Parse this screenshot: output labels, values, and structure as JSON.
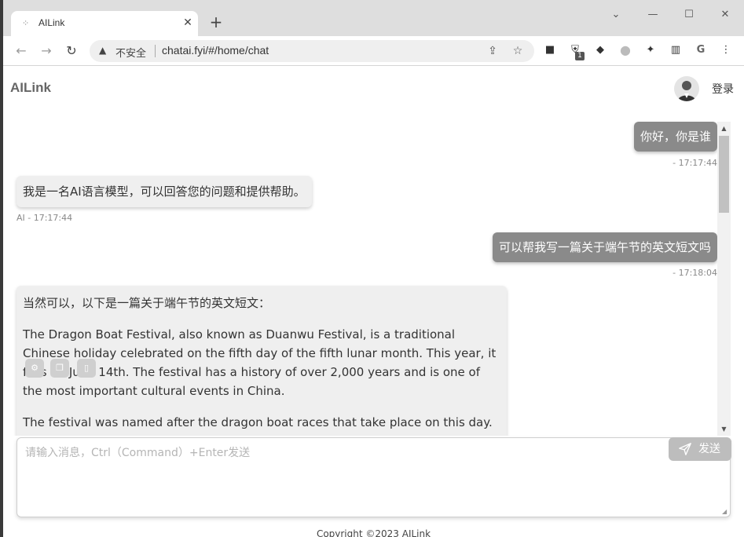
{
  "browser": {
    "tab_title": "AILink",
    "tab_close": "✕",
    "new_tab": "+",
    "insecure_label": "不安全",
    "url": "chatai.fyi/#/home/chat",
    "window_controls": {
      "minimize": "—",
      "maximize": "☐",
      "close": "✕",
      "tab_search": "⌄"
    },
    "extension_badge": "1"
  },
  "header": {
    "brand": "AILink",
    "login_label": "登录"
  },
  "messages": [
    {
      "role": "user",
      "text": "你好，你是谁",
      "meta": "- 17:17:44"
    },
    {
      "role": "ai",
      "text": "我是一名AI语言模型，可以回答您的问题和提供帮助。",
      "meta": "AI - 17:17:44"
    },
    {
      "role": "user",
      "text": "可以帮我写一篇关于端午节的英文短文吗",
      "meta": "- 17:18:04"
    },
    {
      "role": "ai",
      "paragraphs": [
        "当然可以，以下是一篇关于端午节的英文短文：",
        "The Dragon Boat Festival, also known as Duanwu Festival, is a traditional Chinese holiday celebrated on the fifth day of the fifth lunar month. This year, it falls on June 14th. The festival has a history of over 2,000 years and is one of the most important cultural events in China.",
        "The festival was named after the dragon boat races that take place on this day. Teams of rowers race in long, narrow boats decorated with dragon heads and tails. The"
      ]
    }
  ],
  "input": {
    "placeholder": "请输入消息，Ctrl（Command）+Enter发送",
    "value": "",
    "send_label": "发送"
  },
  "footer": {
    "copyright": "Copyright ©2023 AILink"
  }
}
